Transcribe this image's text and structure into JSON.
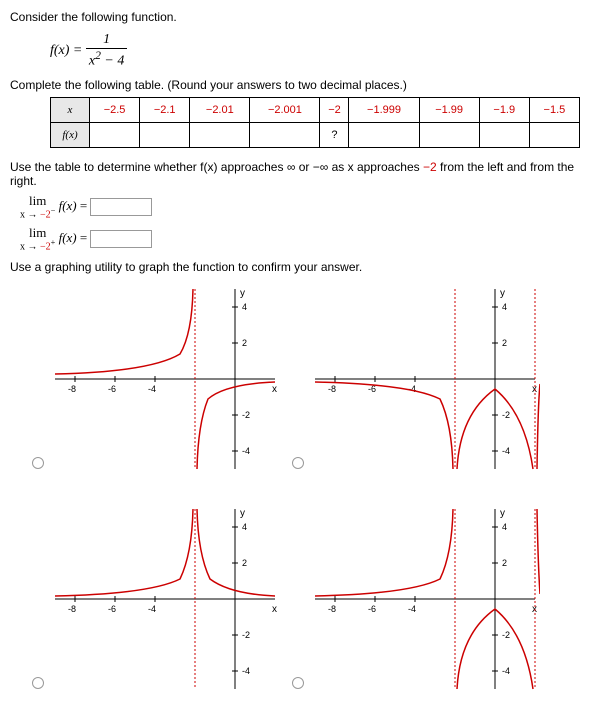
{
  "intro": "Consider the following function.",
  "function_lhs": "f(x) =",
  "function_num": "1",
  "function_den_a": "x",
  "function_den_exp": "2",
  "function_den_b": " − 4",
  "table_instruction": "Complete the following table. (Round your answers to two decimal places.)",
  "table": {
    "row1_label": "x",
    "row2_label": "f(x)",
    "values": [
      "−2.5",
      "−2.1",
      "−2.01",
      "−2.001",
      "−2",
      "−1.999",
      "−1.99",
      "−1.9",
      "−1.5"
    ],
    "center_value": "?"
  },
  "limits_instruction": "Use the table to determine whether f(x) approaches ∞ or −∞ as x approaches ",
  "limits_approach_value": "−2",
  "limits_instruction_end": " from the left and from the right.",
  "limit1_top": "lim",
  "limit1_bot_a": "x → ",
  "limit1_bot_b": "−2",
  "limit1_sup": "−",
  "limit1_fx": " f(x)",
  "limit2_top": "lim",
  "limit2_bot_a": "x → ",
  "limit2_bot_b": "−2",
  "limit2_sup": "+",
  "limit2_fx": " f(x)",
  "graph_instruction": "Use a graphing utility to graph the function to confirm your answer.",
  "axis_x": "x",
  "axis_y": "y",
  "yticks": [
    "4",
    "2",
    "-2",
    "-4"
  ],
  "xticks": [
    "-8",
    "-6",
    "-4"
  ],
  "chart_data": [
    {
      "type": "function-plot",
      "asymptote_x": -2,
      "xrange": [
        -9,
        2
      ],
      "yrange": [
        -5,
        5
      ],
      "left_branch": "up",
      "right_branch": "down",
      "has_second_asymptote": false
    },
    {
      "type": "function-plot",
      "asymptote_x": -2,
      "asymptote_x2": 2,
      "xrange": [
        -9,
        2
      ],
      "yrange": [
        -5,
        5
      ],
      "left_branch": "down",
      "right_branch": "down"
    },
    {
      "type": "function-plot",
      "asymptote_x": -2,
      "xrange": [
        -9,
        2
      ],
      "yrange": [
        -5,
        5
      ],
      "left_branch": "up",
      "right_branch": "up",
      "has_second_asymptote": false
    },
    {
      "type": "function-plot",
      "asymptote_x": -2,
      "asymptote_x2": 2,
      "xrange": [
        -9,
        2
      ],
      "yrange": [
        -5,
        5
      ],
      "left_branch": "up",
      "right_branch": "down"
    }
  ]
}
